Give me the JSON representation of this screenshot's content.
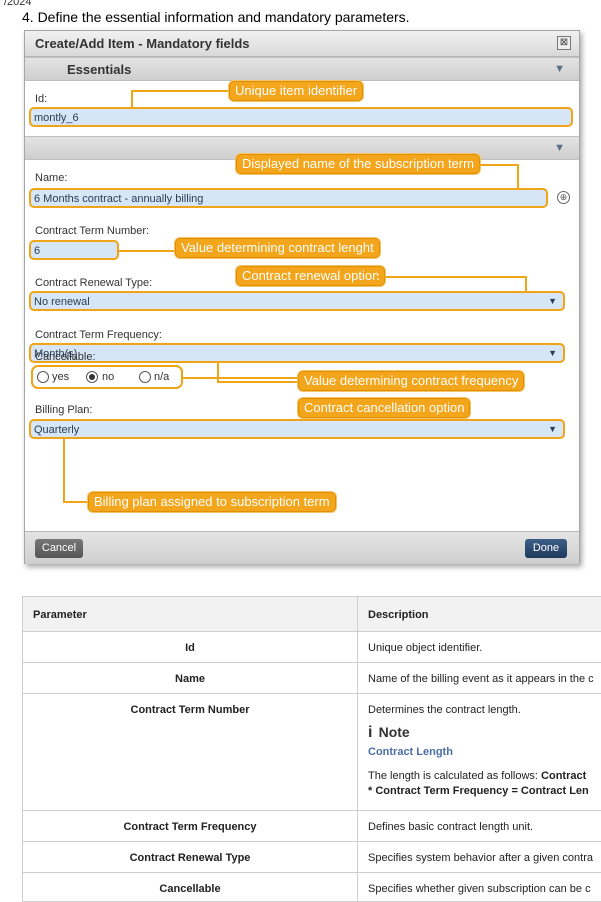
{
  "page": {
    "date_fragment": "/2024",
    "step_text": "4. Define the essential information and mandatory parameters."
  },
  "dialog": {
    "title": "Create/Add Item - Mandatory fields",
    "close_glyph": "⊠",
    "section1_title": "Essentials",
    "section_arrow": "▼",
    "id_label": "Id:",
    "id_value": "montly_6",
    "name_label": "Name:",
    "name_value": "6 Months contract - annually billing",
    "term_number_label": "Contract Term Number:",
    "term_number_value": "6",
    "renewal_label": "Contract Renewal Type:",
    "renewal_value": "No renewal",
    "frequency_label": "Contract Term Frequency:",
    "frequency_value": "Month(s)",
    "cancellable_label": "Cancellable:",
    "cancellable_options": [
      "yes",
      "no",
      "n/a"
    ],
    "cancellable_selected": "no",
    "billing_label": "Billing Plan:",
    "billing_value": "Quarterly",
    "cancel_label": "Cancel",
    "done_label": "Done"
  },
  "callouts": {
    "id": "Unique item identifier",
    "name": "Displayed name of the subscription term",
    "term_number": "Value determining contract lenght",
    "renewal": "Contract renewal option",
    "frequency": "Value determining contract frequency",
    "cancellable": "Contract cancellation option",
    "billing": "Billing plan assigned to subscription term"
  },
  "table": {
    "headers": [
      "Parameter",
      "Description"
    ],
    "rows": [
      {
        "param": "Id",
        "desc": "Unique object identifier."
      },
      {
        "param": "Name",
        "desc": "Name of the billing event as it appears in the c"
      },
      {
        "param": "Contract Term Number",
        "desc": "Determines the contract length."
      },
      {
        "param": "Contract Term Frequency",
        "desc": "Defines basic contract length unit."
      },
      {
        "param": "Contract Renewal Type",
        "desc": "Specifies system behavior after a given contra"
      },
      {
        "param": "Cancellable",
        "desc": "Specifies whether given subscription can be c"
      }
    ],
    "note": {
      "icon": "i",
      "title": "Note",
      "subtitle": "Contract Length",
      "line1_prefix": "The length is calculated as follows: ",
      "line1_bold": "Contract",
      "line2": "* Contract Term Frequency = Contract Len"
    }
  },
  "colors": {
    "callout": "#f3a51b",
    "field_fill": "#d6e6f7",
    "done_button": "#1f3a5c"
  }
}
